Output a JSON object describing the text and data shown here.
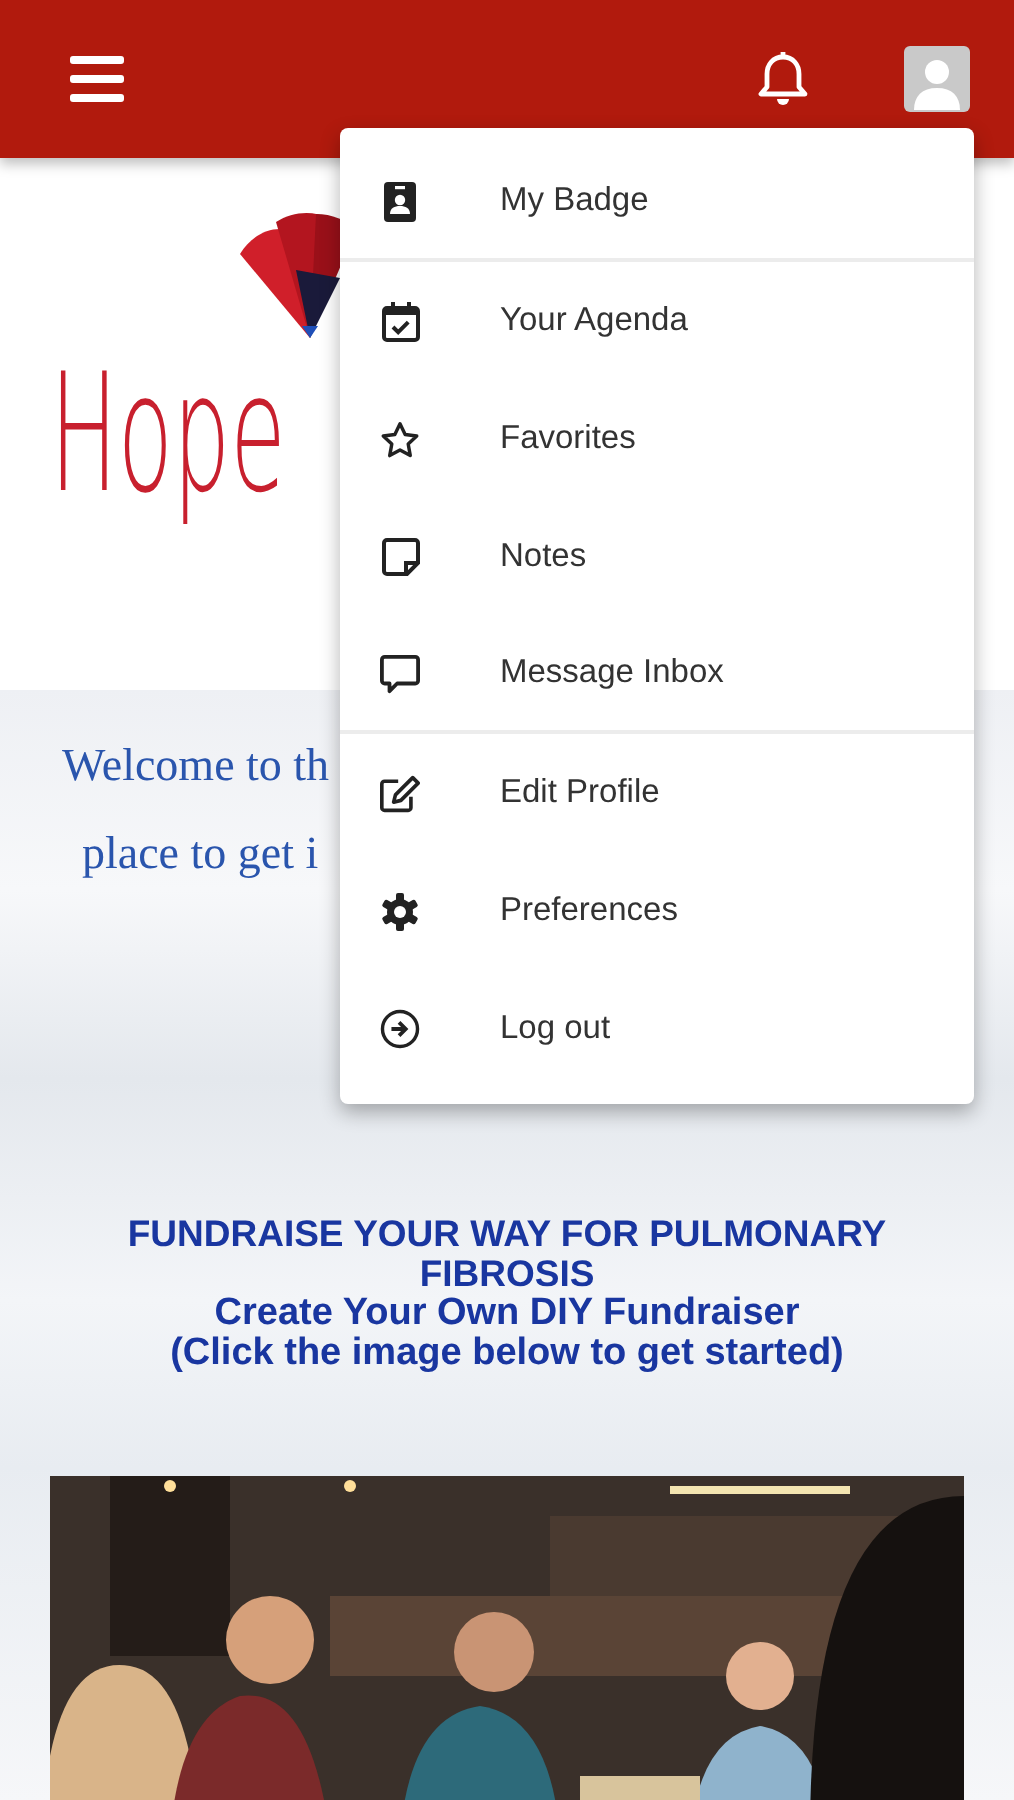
{
  "logo": {
    "text": "Hope"
  },
  "welcome": [
    "Welcome to th",
    "place to get i"
  ],
  "user_menu": {
    "items": [
      {
        "label": "My Badge",
        "kind": "badge",
        "divider_after": true
      },
      {
        "label": "Your Agenda",
        "kind": "agenda",
        "divider_after": false
      },
      {
        "label": "Favorites",
        "kind": "favorites",
        "divider_after": false
      },
      {
        "label": "Notes",
        "kind": "notes",
        "divider_after": false
      },
      {
        "label": "Message Inbox",
        "kind": "inbox",
        "divider_after": true
      },
      {
        "label": "Edit Profile",
        "kind": "edit",
        "divider_after": false
      },
      {
        "label": "Preferences",
        "kind": "preferences",
        "divider_after": false
      },
      {
        "label": "Log out",
        "kind": "logout",
        "divider_after": false
      }
    ]
  },
  "promo": {
    "lines": [
      {
        "text": "FUNDRAISE YOUR WAY FOR PULMONARY FIBROSIS",
        "kind": "headline"
      },
      {
        "text": "Create Your Own DIY Fundraiser",
        "kind": "subline"
      },
      {
        "text": "(Click the image below to get started)",
        "kind": "subline"
      }
    ]
  },
  "banner": {
    "kind": "picture"
  }
}
